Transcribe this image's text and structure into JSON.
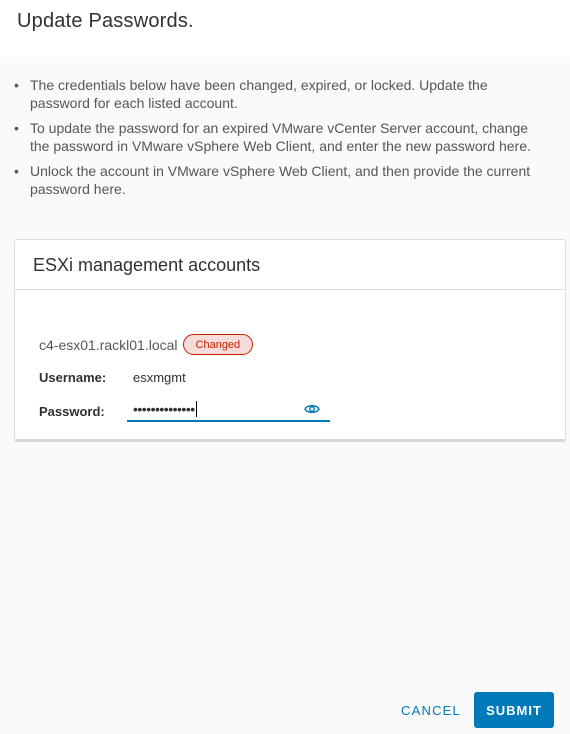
{
  "dialog": {
    "title": "Update Passwords."
  },
  "instructions": [
    "The credentials below have been changed, expired, or locked. Update the password for each listed account.",
    "To update the password for an expired VMware vCenter Server account, change the password in VMware vSphere Web Client, and enter the new password here.",
    "Unlock the account in VMware vSphere Web Client, and then provide the current password here."
  ],
  "card": {
    "title": "ESXi management accounts",
    "host": "c4-esx01.rackl01.local",
    "status": "Changed",
    "username_label": "Username:",
    "username_value": "esxmgmt",
    "password_label": "Password:",
    "password_masked": "••••••••••••••",
    "reveal_icon": "eye-icon"
  },
  "footer": {
    "cancel_label": "CANCEL",
    "submit_label": "SUBMIT"
  },
  "colors": {
    "accent": "#0079b8",
    "status_border": "#c92100",
    "status_bg": "#f5dbd9"
  }
}
